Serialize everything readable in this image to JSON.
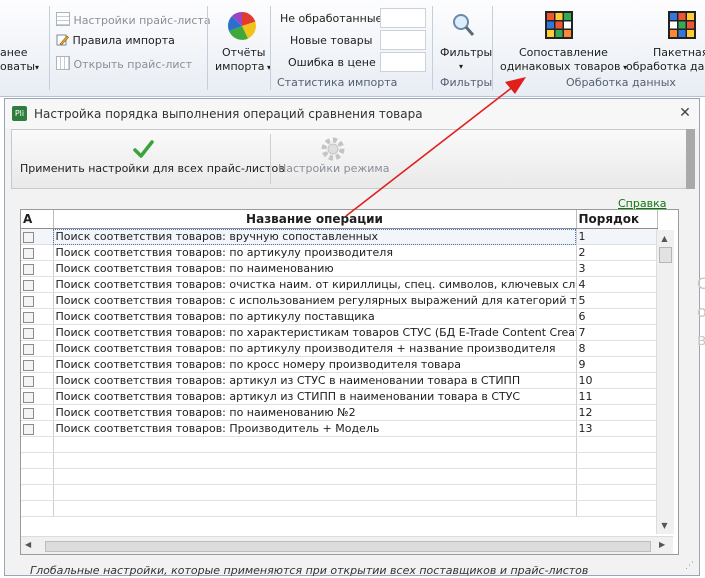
{
  "ribbon": {
    "left_partial": [
      "анее",
      "оваты"
    ],
    "price_list_settings": "Настройки прайс-листа",
    "import_rules": "Правила импорта",
    "open_price_list": "Открыть прайс-лист",
    "import_reports": [
      "Отчёты",
      "импорта"
    ],
    "stat_unprocessed": "Не обработанные",
    "stat_new_products": "Новые товары",
    "stat_price_error": "Ошибка в цене",
    "group_import_stats": "Статистика импорта",
    "filters": "Фильтры",
    "group_filters": "Фильтры",
    "match_same_products": [
      "Сопоставление",
      "одинаковых товаров"
    ],
    "batch_processing": [
      "Пакетная",
      "обработка дан"
    ],
    "group_data_processing": "Обработка данных"
  },
  "dialog": {
    "title": "Настройка порядка выполнения операций сравнения товара",
    "app_icon_text": "Pli",
    "close_glyph": "✕",
    "apply_all_button": "Применить настройки для всех прайс-листов",
    "mode_settings_button": "Настройки режима",
    "help_link": "Справка",
    "status_text": "Глобальные настройки, которые применяются при открытии всех поставщиков и прайс-листов"
  },
  "table": {
    "columns": [
      "А",
      "Название операции",
      "Порядок"
    ],
    "rows": [
      {
        "name": "Поиск соответствия товаров: вручную сопоставленных",
        "order": "1"
      },
      {
        "name": "Поиск соответствия товаров: по артикулу производителя",
        "order": "2"
      },
      {
        "name": "Поиск соответствия товаров: по наименованию",
        "order": "3"
      },
      {
        "name": "Поиск соответствия товаров: очистка наим. от кириллицы, спец. символов, ключевых слов, поиск од",
        "order": "4"
      },
      {
        "name": "Поиск соответствия товаров: с использованием регулярных выражений для категорий товара",
        "order": "5"
      },
      {
        "name": "Поиск соответствия товаров: по артикулу поставщика",
        "order": "6"
      },
      {
        "name": "Поиск соответствия товаров: по характеристикам товаров СТУС (БД E-Trade Content Creator)",
        "order": "7"
      },
      {
        "name": "Поиск соответствия товаров: по артикулу производителя + название производителя",
        "order": "8"
      },
      {
        "name": "Поиск соответствия товаров: по кросс номеру производителя товара",
        "order": "9"
      },
      {
        "name": "Поиск соответствия товаров: артикул из СТУС в наименовании товара в СТИПП",
        "order": "10"
      },
      {
        "name": "Поиск соответствия товаров: артикул из СТИПП в наименовании товара в СТУС",
        "order": "11"
      },
      {
        "name": "Поиск соответствия товаров: по наименованию №2",
        "order": "12"
      },
      {
        "name": "Поиск соответствия товаров: Производитель + Модель",
        "order": "13"
      }
    ],
    "empty_rows": 5
  },
  "colors": {
    "accent_arrow": "#e0201b",
    "help_link": "#0a7a0a",
    "check_green": "#3aa33a"
  }
}
